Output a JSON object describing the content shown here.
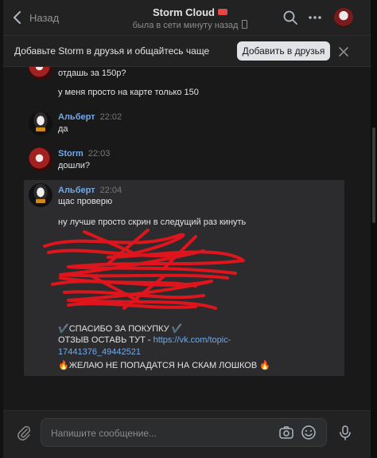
{
  "header": {
    "back_label": "Назад",
    "title": "Storm Cloud",
    "status": "была в сети минуту назад"
  },
  "banner": {
    "text": "Добавьте Storm в друзья и общайтесь чаще",
    "button_label": "Добавить в друзья"
  },
  "messages": {
    "top_partial": {
      "lines": [
        "отдашь за 150р?",
        "у меня просто на карте только 150"
      ]
    },
    "m1": {
      "author": "Альберт",
      "time": "22:02",
      "lines": [
        "да"
      ]
    },
    "m2": {
      "author": "Storm",
      "time": "22:03",
      "lines": [
        "дошли?"
      ]
    },
    "m3": {
      "author": "Альберт",
      "time": "22:04",
      "lines": [
        "щас проверю",
        "ну лучше просто скрин в следущий раз кинуть"
      ],
      "thanks": "✔️СПАСИБО ЗА ПОКУПКУ ✔️",
      "review_prefix": "ОТЗЫВ ОСТАВЬ ТУТ - ",
      "review_link_part1": "https://vk.com/topic-",
      "review_link_part2": "17441376_49442521",
      "wish": "🔥ЖЕЛАЮ НЕ ПОПАДАТСЯ НА СКАМ ЛОШКОВ 🔥"
    }
  },
  "composer": {
    "placeholder": "Напишите сообщение..."
  },
  "colors": {
    "background": "#19191a",
    "panel": "#222223",
    "accent_link": "#71aaeb",
    "highlight": "#2c2c2e",
    "redaction": "#e8141c"
  }
}
